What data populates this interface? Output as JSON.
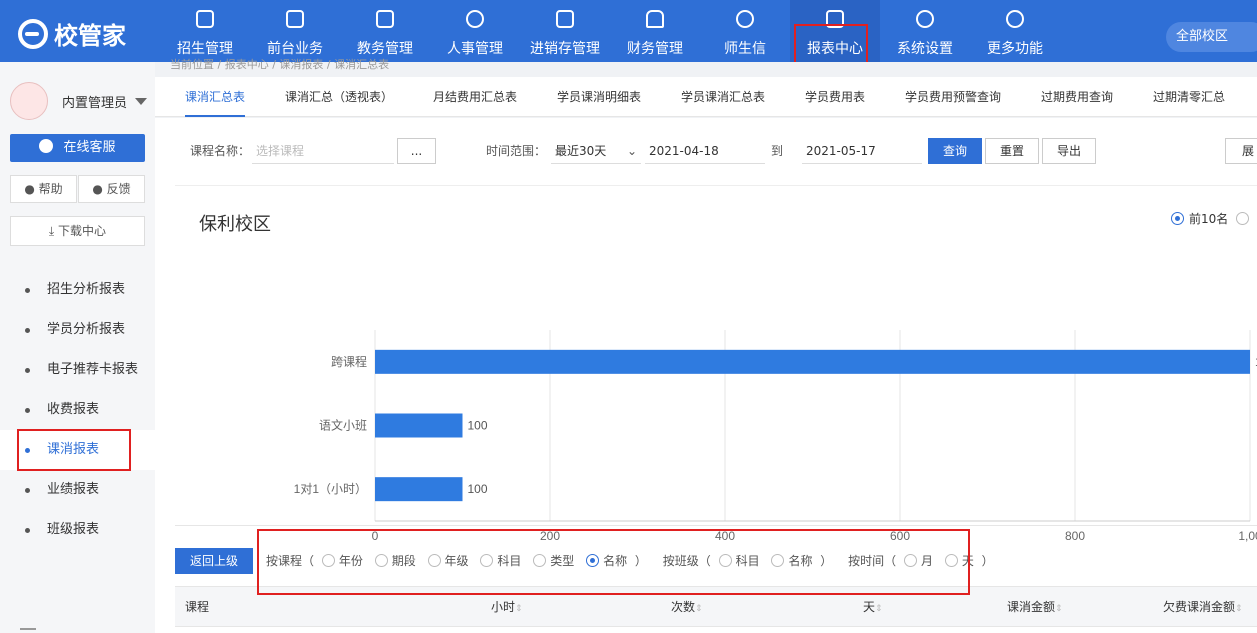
{
  "app": {
    "logo": "校管家"
  },
  "nav": [
    {
      "label": "招生管理"
    },
    {
      "label": "前台业务"
    },
    {
      "label": "教务管理"
    },
    {
      "label": "人事管理"
    },
    {
      "label": "进销存管理"
    },
    {
      "label": "财务管理"
    },
    {
      "label": "师生信"
    },
    {
      "label": "报表中心"
    },
    {
      "label": "系统设置"
    },
    {
      "label": "更多功能"
    }
  ],
  "campus_selector": "全部校区",
  "user": {
    "name": "内置管理员"
  },
  "sidebar": {
    "service_button": "在线客服",
    "help_button": "帮助",
    "feedback_button": "反馈",
    "download_button": "下载中心",
    "items": [
      {
        "label": "招生分析报表"
      },
      {
        "label": "学员分析报表"
      },
      {
        "label": "电子推荐卡报表"
      },
      {
        "label": "收费报表"
      },
      {
        "label": "课消报表"
      },
      {
        "label": "业绩报表"
      },
      {
        "label": "班级报表"
      }
    ]
  },
  "breadcrumb": "当前位置 / 报表中心 / 课消报表 / 课消汇总表",
  "tabs": [
    {
      "label": "课消汇总表"
    },
    {
      "label": "课消汇总（透视表）"
    },
    {
      "label": "月结费用汇总表"
    },
    {
      "label": "学员课消明细表"
    },
    {
      "label": "学员课消汇总表"
    },
    {
      "label": "学员费用表"
    },
    {
      "label": "学员费用预警查询"
    },
    {
      "label": "过期费用查询"
    },
    {
      "label": "过期清零汇总"
    }
  ],
  "filters": {
    "course_label": "课程名称：",
    "course_placeholder": "选择课程",
    "course_more": "...",
    "range_label": "时间范围：",
    "range_value": "最近30天",
    "date_from": "2021-04-18",
    "to_label": "到",
    "date_to": "2021-05-17",
    "query_button": "查询",
    "reset_button": "重置",
    "export_button": "导出",
    "expand_button": "展"
  },
  "campus_title": "保利校区",
  "topn": {
    "option1": "前10名"
  },
  "chart_data": {
    "type": "bar",
    "orientation": "horizontal",
    "categories": [
      "跨课程",
      "语文小班",
      "1对1（小时）"
    ],
    "values": [
      1000,
      100,
      100
    ],
    "value_labels": [
      "1",
      "100",
      "100"
    ],
    "xlim": [
      0,
      1000
    ],
    "xticks": [
      "0",
      "200",
      "400",
      "600",
      "800",
      "1,00"
    ],
    "grid": true,
    "color": "#2f7be0"
  },
  "back_button": "返回上级",
  "group_by": {
    "course_label": "按课程（",
    "course_options": [
      "年份",
      "期段",
      "年级",
      "科目",
      "类型",
      "名称"
    ],
    "course_selected": "名称",
    "course_close": "）",
    "class_label": "按班级（",
    "class_options": [
      "科目",
      "名称"
    ],
    "class_close": "）",
    "time_label": "按时间（",
    "time_options": [
      "月",
      "天"
    ],
    "time_close": "）"
  },
  "table": {
    "headers": [
      "课程",
      "小时",
      "次数",
      "天",
      "课消金额",
      "欠费课消金额"
    ]
  }
}
